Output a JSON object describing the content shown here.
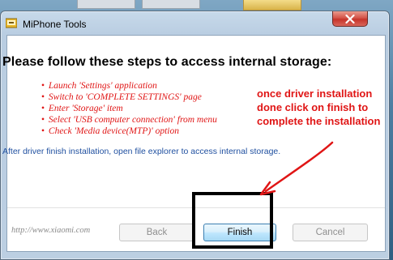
{
  "window": {
    "title": "MiPhone Tools",
    "close_icon": "close-icon"
  },
  "content": {
    "heading": "Please follow these steps to access internal storage:",
    "steps": [
      "Launch 'Settings' application",
      "Switch to 'COMPLETE SETTINGS' page",
      "Enter 'Storage' item",
      "Select 'USB computer connection' from menu",
      "Check 'Media device(MTP)' option"
    ],
    "info": "After driver finish installation, open file explorer to access internal storage."
  },
  "annotation": {
    "text": "once driver installation done click on finish to complete the installation",
    "color": "#e01515"
  },
  "footer": {
    "link": "http://www.xiaomi.com",
    "back_label": "Back",
    "finish_label": "Finish",
    "cancel_label": "Cancel"
  }
}
